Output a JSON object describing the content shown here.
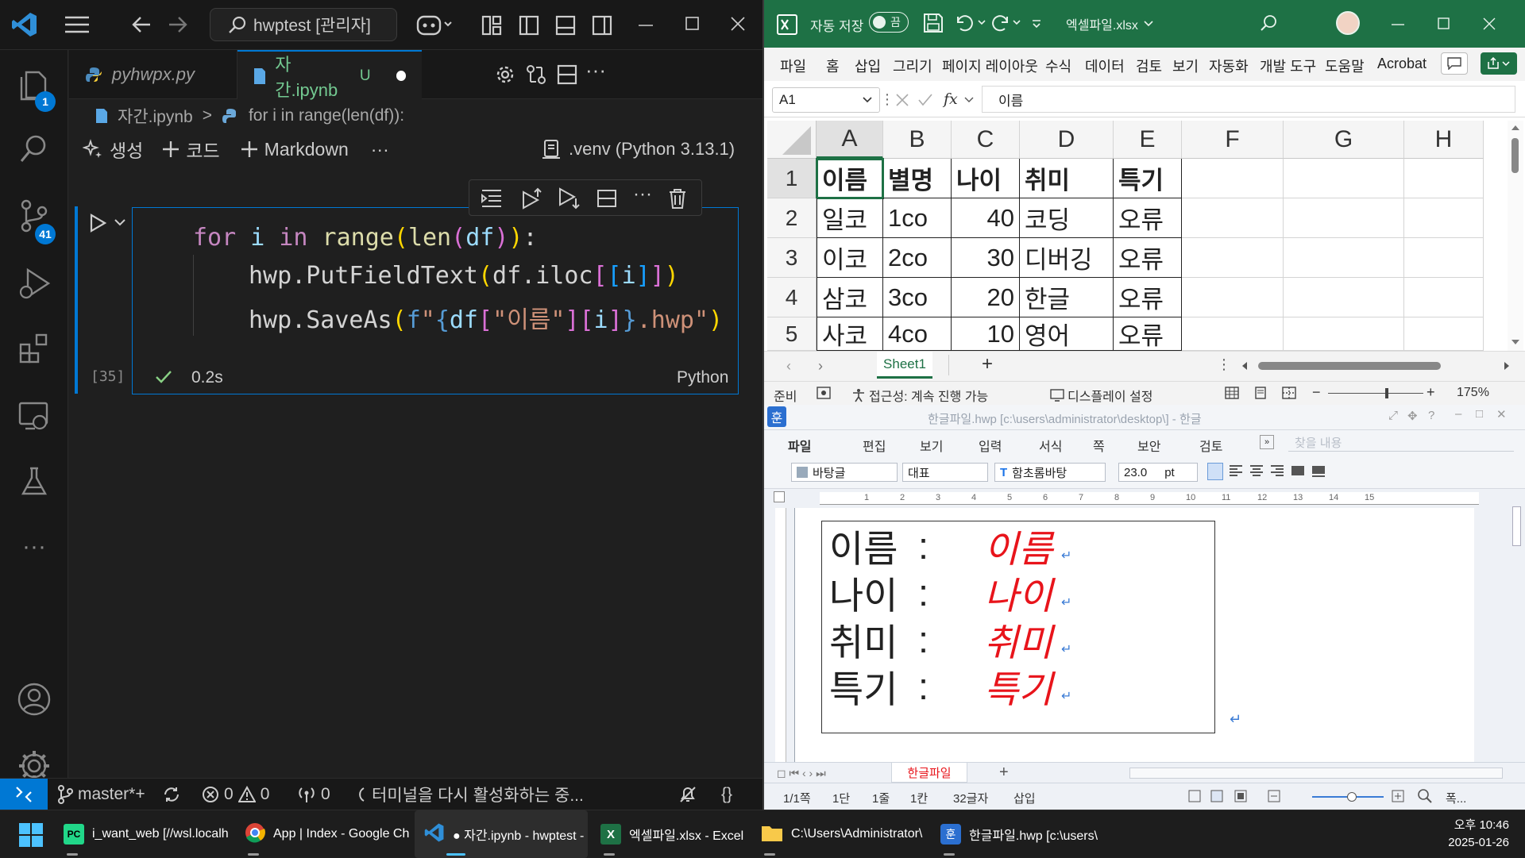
{
  "vscode": {
    "title_search": "hwptest [관리자]",
    "tabs": [
      {
        "label": "pyhwpx.py",
        "active": false
      },
      {
        "label": "자간.ipynb",
        "modified_mark": "U",
        "active": true
      }
    ],
    "breadcrumb": {
      "file": "자간.ipynb",
      "sep": ">",
      "symbol": "for i in range(len(df)):"
    },
    "notebook_toolbar": {
      "generate": "생성",
      "code": "코드",
      "markdown": "Markdown",
      "more": "···",
      "kernel": ".venv (Python 3.13.1)"
    },
    "activity_badges": {
      "explorer": "1",
      "source_control": "41"
    },
    "cell": {
      "exec_count": "[35]",
      "time": "0.2s",
      "language": "Python",
      "lines": {
        "l1": {
          "kw1": "for",
          "v": " i ",
          "kw2": "in",
          "fn": " range",
          "p1": "(",
          "fn2": "len",
          "p2": "(",
          "arg": "df",
          "p3": ")",
          "p4": ")",
          "colon": ":"
        },
        "l2": {
          "obj": "hwp.PutFieldText",
          "p1": "(",
          "obj2": "df.iloc",
          "b1": "[",
          "b2": "[",
          "i": "i",
          "b3": "]",
          "b4": "]",
          "p2": ")"
        },
        "l3": {
          "obj": "hwp.SaveAs",
          "p1": "(",
          "f": "f",
          "q1": "\"",
          "br1": "{",
          "df": "df",
          "b1": "[",
          "s": "\"이름\"",
          "b2": "]",
          "b3": "[",
          "i": "i",
          "b4": "]",
          "br2": "}",
          "ext": ".hwp",
          "q2": "\"",
          "p2": ")"
        }
      }
    },
    "status": {
      "remote": "><",
      "branch": "master*+",
      "errors": "0",
      "warnings": "0",
      "ports": "0",
      "message": "터미널을 다시 활성화하는 중...",
      "braces": "{}"
    }
  },
  "excel": {
    "autosave": "자동 저장",
    "toggle": "끔",
    "filename": "엑셀파일.xlsx",
    "menu": [
      "파일",
      "홈",
      "삽입",
      "그리기",
      "페이지 레이아웃",
      "수식",
      "데이터",
      "검토",
      "보기",
      "자동화",
      "개발 도구",
      "도움말",
      "Acrobat"
    ],
    "namebox": "A1",
    "fx": "fx",
    "formula": "이름",
    "columns": [
      "A",
      "B",
      "C",
      "D",
      "E",
      "F",
      "G",
      "H"
    ],
    "rows": [
      "1",
      "2",
      "3",
      "4",
      "5"
    ],
    "cells": [
      [
        "이름",
        "별명",
        "나이",
        "취미",
        "특기"
      ],
      [
        "일코",
        "1co",
        "40",
        "코딩",
        "오류"
      ],
      [
        "이코",
        "2co",
        "30",
        "디버깅",
        "오류"
      ],
      [
        "삼코",
        "3co",
        "20",
        "한글",
        "오류"
      ],
      [
        "사코",
        "4co",
        "10",
        "영어",
        "오류"
      ]
    ],
    "sheet_tab": "Sheet1",
    "status_ready": "준비",
    "accessibility": "접근성: 계속 진행 가능",
    "display": "디스플레이 설정",
    "zoom": "175%"
  },
  "hwp": {
    "title": "한글파일.hwp [c:\\users\\administrator\\desktop\\] - 한글",
    "menu": [
      "파일",
      "편집",
      "보기",
      "입력",
      "서식",
      "쪽",
      "보안",
      "검토"
    ],
    "search_placeholder": "찾을 내용",
    "style": "바탕글",
    "outline": "대표",
    "font": "함초롬바탕",
    "size": "23.0",
    "unit": "pt",
    "ruler": [
      "1",
      "2",
      "3",
      "4",
      "5",
      "6",
      "7",
      "8",
      "9",
      "10",
      "11",
      "12",
      "13",
      "14",
      "15"
    ],
    "fields": [
      {
        "label": "이름",
        "colon": ":",
        "value": "이름"
      },
      {
        "label": "나이",
        "colon": ":",
        "value": "나이"
      },
      {
        "label": "취미",
        "colon": ":",
        "value": "취미"
      },
      {
        "label": "특기",
        "colon": ":",
        "value": "특기"
      }
    ],
    "sheet_tab": "한글파일",
    "status": [
      "1/1쪽",
      "1단",
      "1줄",
      "1칸",
      "32글자",
      "삽입"
    ],
    "zoom_label": "폭..."
  },
  "taskbar": {
    "items": [
      {
        "label": "i_want_web [//wsl.localh"
      },
      {
        "label": "App | Index - Google Ch"
      },
      {
        "label": "● 자간.ipynb - hwptest -"
      },
      {
        "label": "엑셀파일.xlsx - Excel"
      },
      {
        "label": "C:\\Users\\Administrator\\"
      },
      {
        "label": "한글파일.hwp [c:\\users\\"
      }
    ],
    "time": "오후 10:46",
    "date": "2025-01-26"
  }
}
